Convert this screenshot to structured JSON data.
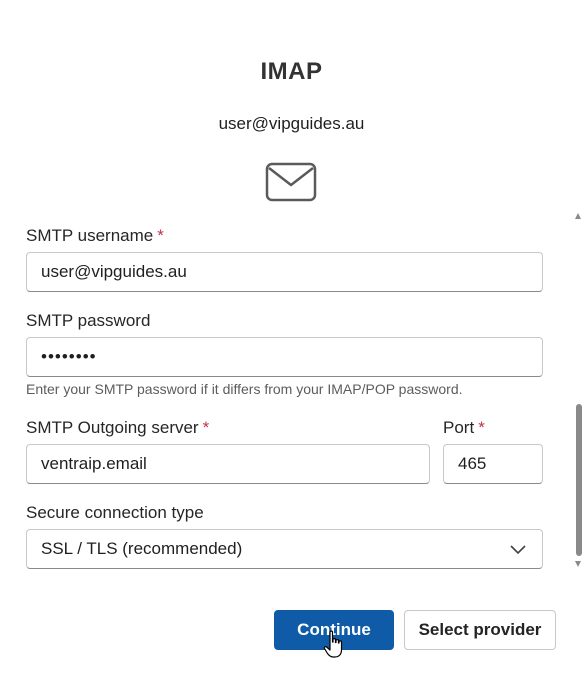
{
  "header": {
    "title": "IMAP",
    "email": "user@vipguides.au",
    "icon": "mail-icon"
  },
  "form": {
    "smtp_username": {
      "label": "SMTP username",
      "required": "*",
      "value": "user@vipguides.au"
    },
    "smtp_password": {
      "label": "SMTP password",
      "value": "••••••••",
      "help": "Enter your SMTP password if it differs from your IMAP/POP password."
    },
    "smtp_server": {
      "label": "SMTP Outgoing server",
      "required": "*",
      "value": "ventraip.email"
    },
    "port": {
      "label": "Port",
      "required": "*",
      "value": "465"
    },
    "secure_connection": {
      "label": "Secure connection type",
      "value": "SSL / TLS (recommended)"
    }
  },
  "actions": {
    "continue_label": "Continue",
    "select_provider_label": "Select provider"
  },
  "colors": {
    "primary": "#0f5ba7",
    "required": "#c4314b"
  }
}
